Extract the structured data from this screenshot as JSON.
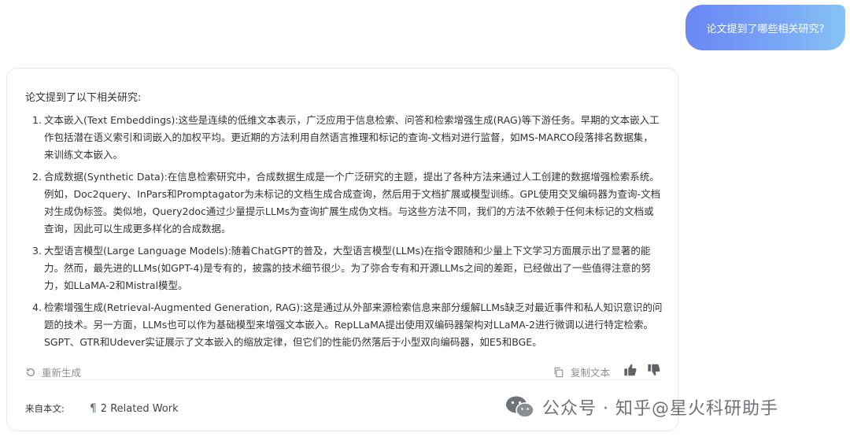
{
  "user_message": "论文提到了哪些相关研究?",
  "answer": {
    "intro": "论文提到了以下相关研究:",
    "items": [
      {
        "num": "1.",
        "text": "文本嵌入(Text Embeddings):这些是连续的低维文本表示，广泛应用于信息检索、问答和检索增强生成(RAG)等下游任务。早期的文本嵌入工作包括潜在语义索引和词嵌入的加权平均。更近期的方法利用自然语言推理和标记的查询-文档对进行监督，如MS-MARCO段落排名数据集，来训练文本嵌入。"
      },
      {
        "num": "2.",
        "text": "合成数据(Synthetic Data):在信息检索研究中，合成数据生成是一个广泛研究的主题，提出了各种方法来通过人工创建的数据增强检索系统。例如，Doc2query、InPars和Promptagator为未标记的文档生成合成查询，然后用于文档扩展或模型训练。GPL使用交叉编码器为查询-文档对生成伪标签。类似地，Query2doc通过少量提示LLMs为查询扩展生成伪文档。与这些方法不同，我们的方法不依赖于任何未标记的文档或查询，因此可以生成更多样化的合成数据。"
      },
      {
        "num": "3.",
        "text": "大型语言模型(Large Language Models):随着ChatGPT的普及，大型语言模型(LLMs)在指令跟随和少量上下文学习方面展示出了显著的能力。然而，最先进的LLMs(如GPT-4)是专有的，披露的技术细节很少。为了弥合专有和开源LLMs之间的差距，已经做出了一些值得注意的努力，如LLaMA-2和Mistral模型。"
      },
      {
        "num": "4.",
        "text": "检索增强生成(Retrieval-Augmented Generation, RAG):这是通过从外部来源检索信息来部分缓解LLMs缺乏对最近事件和私人知识意识的问题的技术。另一方面，LLMs也可以作为基础模型来增强文本嵌入。RepLLaMA提出使用双编码器架构对LLaMA-2进行微调以进行特定检索。SGPT、GTR和Udever实证展示了文本嵌入的缩放定律，但它们的性能仍然落后于小型双向编码器，如E5和BGE。"
      }
    ]
  },
  "actions": {
    "regenerate_label": "重新生成",
    "copy_label": "复制文本",
    "thumb_up_icon": "thumb-up-icon",
    "thumb_down_icon": "thumb-down-icon"
  },
  "source": {
    "label": "来自本文:",
    "link_text": "2 Related Work"
  },
  "watermark": {
    "text": "公众号 · 知乎@星火科研助手"
  },
  "colors": {
    "bubble_gradient_start": "#6a86f3",
    "bubble_gradient_end": "#86c4f3",
    "muted": "#8a8f98"
  }
}
